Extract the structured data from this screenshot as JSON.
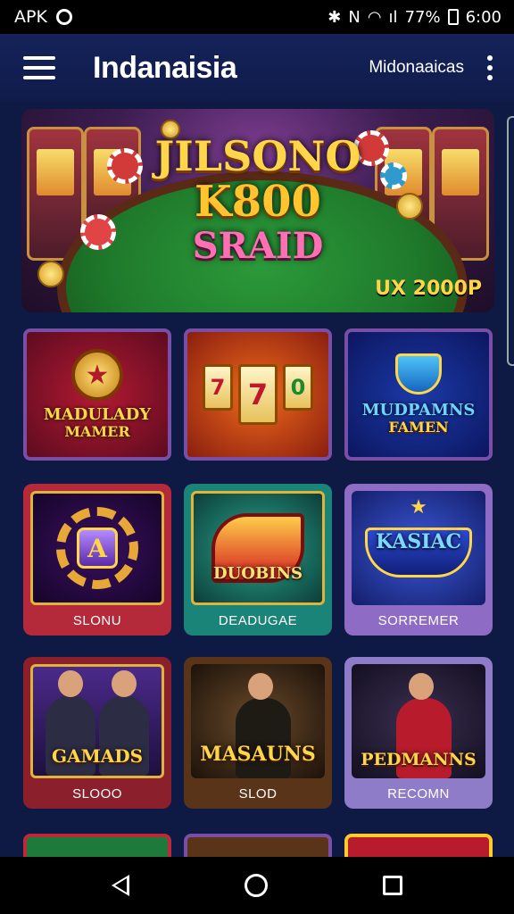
{
  "status_bar": {
    "left_text": "APK",
    "right_text": "\u0001 N \u0001 ill 77%",
    "signal_text": "ıl",
    "battery_text": "77%",
    "time": "6:00"
  },
  "app_bar": {
    "title": "Indanaisia",
    "subtitle": "Midonaaicas"
  },
  "banner": {
    "line1": "JILSONO",
    "line2": "K800",
    "line3": "SRAID",
    "corner_text": "UX 2000P"
  },
  "top_tiles": [
    {
      "label": "MADULADY",
      "sub": "MAMER"
    },
    {
      "label": "",
      "sub": ""
    },
    {
      "label": "MUDPAMNS",
      "sub": "FAMEN"
    }
  ],
  "cards_row2": [
    {
      "art_label": "",
      "caption": "SLONU"
    },
    {
      "art_label": "DUOBINS",
      "caption": "DEADUGAE"
    },
    {
      "art_label": "KASIAC",
      "caption": "SORREMER"
    }
  ],
  "cards_row3": [
    {
      "art_label": "GAMADS",
      "caption": "SLOOO"
    },
    {
      "art_label": "MASAUNS",
      "caption": "SLOD"
    },
    {
      "art_label": "PEDMANNS",
      "caption": "RECOMN"
    }
  ],
  "colors": {
    "background": "#0f1a44",
    "accent_gold": "#ffd54a",
    "tile_border": "#7a4ea6"
  },
  "icons": {
    "menu": "hamburger-icon",
    "more": "kebab-icon",
    "back": "nav-back-icon",
    "home": "nav-home-icon",
    "recents": "nav-recents-icon"
  }
}
